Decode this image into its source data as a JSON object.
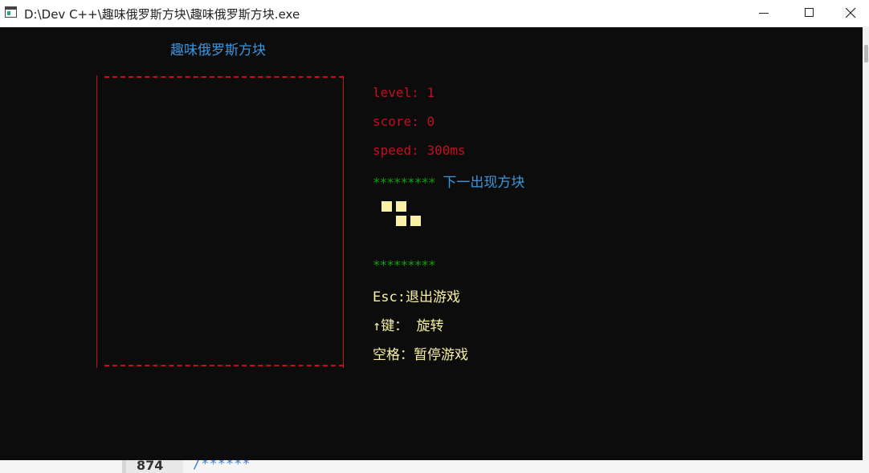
{
  "window": {
    "title": "D:\\Dev C++\\趣味俄罗斯方块\\趣味俄罗斯方块.exe",
    "icon": "console-window-icon"
  },
  "game": {
    "title": "趣味俄罗斯方块",
    "border_color": "#c50f1f",
    "stats": {
      "level_label": "level: ",
      "level_value": "1",
      "score_label": "score: ",
      "score_value": "0",
      "speed_label": "speed: ",
      "speed_value": "300ms"
    },
    "next_block": {
      "stars": "*********",
      "label": "下一出现方块",
      "shape": "Z",
      "color": "#f9f1a5"
    },
    "divider_stars": "*********",
    "controls": {
      "esc": "Esc:退出游戏",
      "rotate": "↑键： 旋转",
      "pause": "空格：暂停游戏"
    }
  },
  "editor_peek": {
    "line_number": "874",
    "code": "/******"
  },
  "colors": {
    "console_bg": "#0c0c0c",
    "red": "#c50f1f",
    "green": "#13a10e",
    "blue": "#3a96dd",
    "yellow": "#f9f1a5"
  }
}
